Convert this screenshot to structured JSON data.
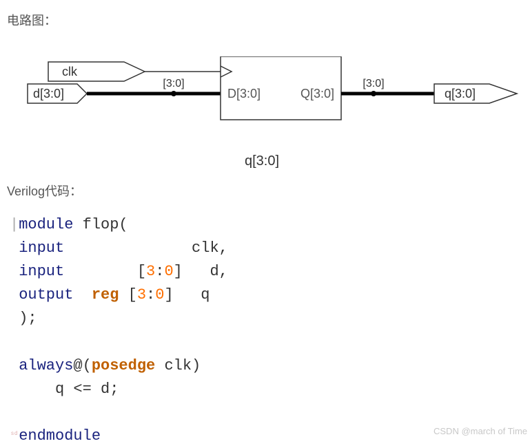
{
  "headings": {
    "diagram": "电路图：",
    "code": "Verilog代码："
  },
  "diagram": {
    "clk_label": "clk",
    "d_label": "d[3:0]",
    "bus_in_label": "[3:0]",
    "port_d": "D[3:0]",
    "port_q": "Q[3:0]",
    "bus_out_label": "[3:0]",
    "q_label": "q[3:0]",
    "caption": "q[3:0]"
  },
  "code": {
    "l1_kw": "module",
    "l1_name": " flop(",
    "l2_kw": "input",
    "l2_rest": "              clk,",
    "l3_kw": "input",
    "l3_open": "        [",
    "l3_hi": "3",
    "l3_mid": ":",
    "l3_lo": "0",
    "l3_close": "]   d,",
    "l4_kw": "output",
    "l4_reg": "  reg",
    "l4_open": " [",
    "l4_hi": "3",
    "l4_mid": ":",
    "l4_lo": "0",
    "l4_close": "]   q",
    "l5": ");",
    "l6_kw": "always",
    "l6_at": "@(",
    "l6_edge": "posedge",
    "l6_sig": " clk)",
    "l7": "    q <= d;",
    "l8_kw": "endmodule"
  },
  "watermark": "CSDN @march of Time",
  "tiny": "sd"
}
